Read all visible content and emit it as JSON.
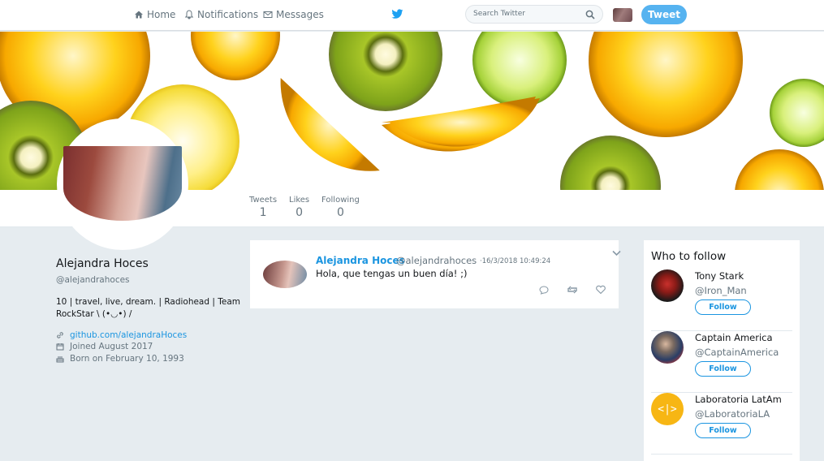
{
  "nav": {
    "home": "Home",
    "notifications": "Notifications",
    "messages": "Messages",
    "search_placeholder": "Search Twitter",
    "tweet_button": "Tweet"
  },
  "stats": {
    "tweets_label": "Tweets",
    "tweets_value": "1",
    "likes_label": "Likes",
    "likes_value": "0",
    "following_label": "Following",
    "following_value": "0"
  },
  "profile": {
    "name": "Alejandra Hoces",
    "handle": "@alejandrahoces",
    "bio": "10 | travel, live, dream. | Radiohead | Team RockStar \\ (•◡•) /",
    "link": "github.com/alejandraHoces",
    "joined": "Joined August 2017",
    "born": "Born on February 10, 1993"
  },
  "tweet": {
    "name": "Alejandra Hoces",
    "handle": "@alejandrahoces",
    "time": "·16/3/2018 10:49:24",
    "text": "Hola, que tengas un buen día! ;)"
  },
  "who_to_follow": {
    "title": "Who to follow",
    "follow_label": "Follow",
    "items": [
      {
        "name": "Tony Stark",
        "handle": "@Iron_Man"
      },
      {
        "name": "Captain America",
        "handle": "@CaptainAmerica"
      },
      {
        "name": "Laboratoria LatAm",
        "handle": "@LaboratoriaLA",
        "logo_text": "<|>"
      }
    ]
  },
  "colors": {
    "accent": "#1b95e0",
    "tweet_button": "#56b3f0",
    "background": "#e6ecf0",
    "laboratoria": "#f7b614"
  },
  "icons": {
    "home": "home-icon",
    "notifications": "bell-icon",
    "messages": "envelope-icon",
    "brand": "twitter-bird-icon",
    "search": "magnifier-icon",
    "link": "link-icon",
    "joined": "calendar-icon",
    "born": "cake-icon",
    "reply": "reply-icon",
    "retweet": "retweet-icon",
    "like": "heart-icon",
    "menu": "chevron-down-icon"
  }
}
